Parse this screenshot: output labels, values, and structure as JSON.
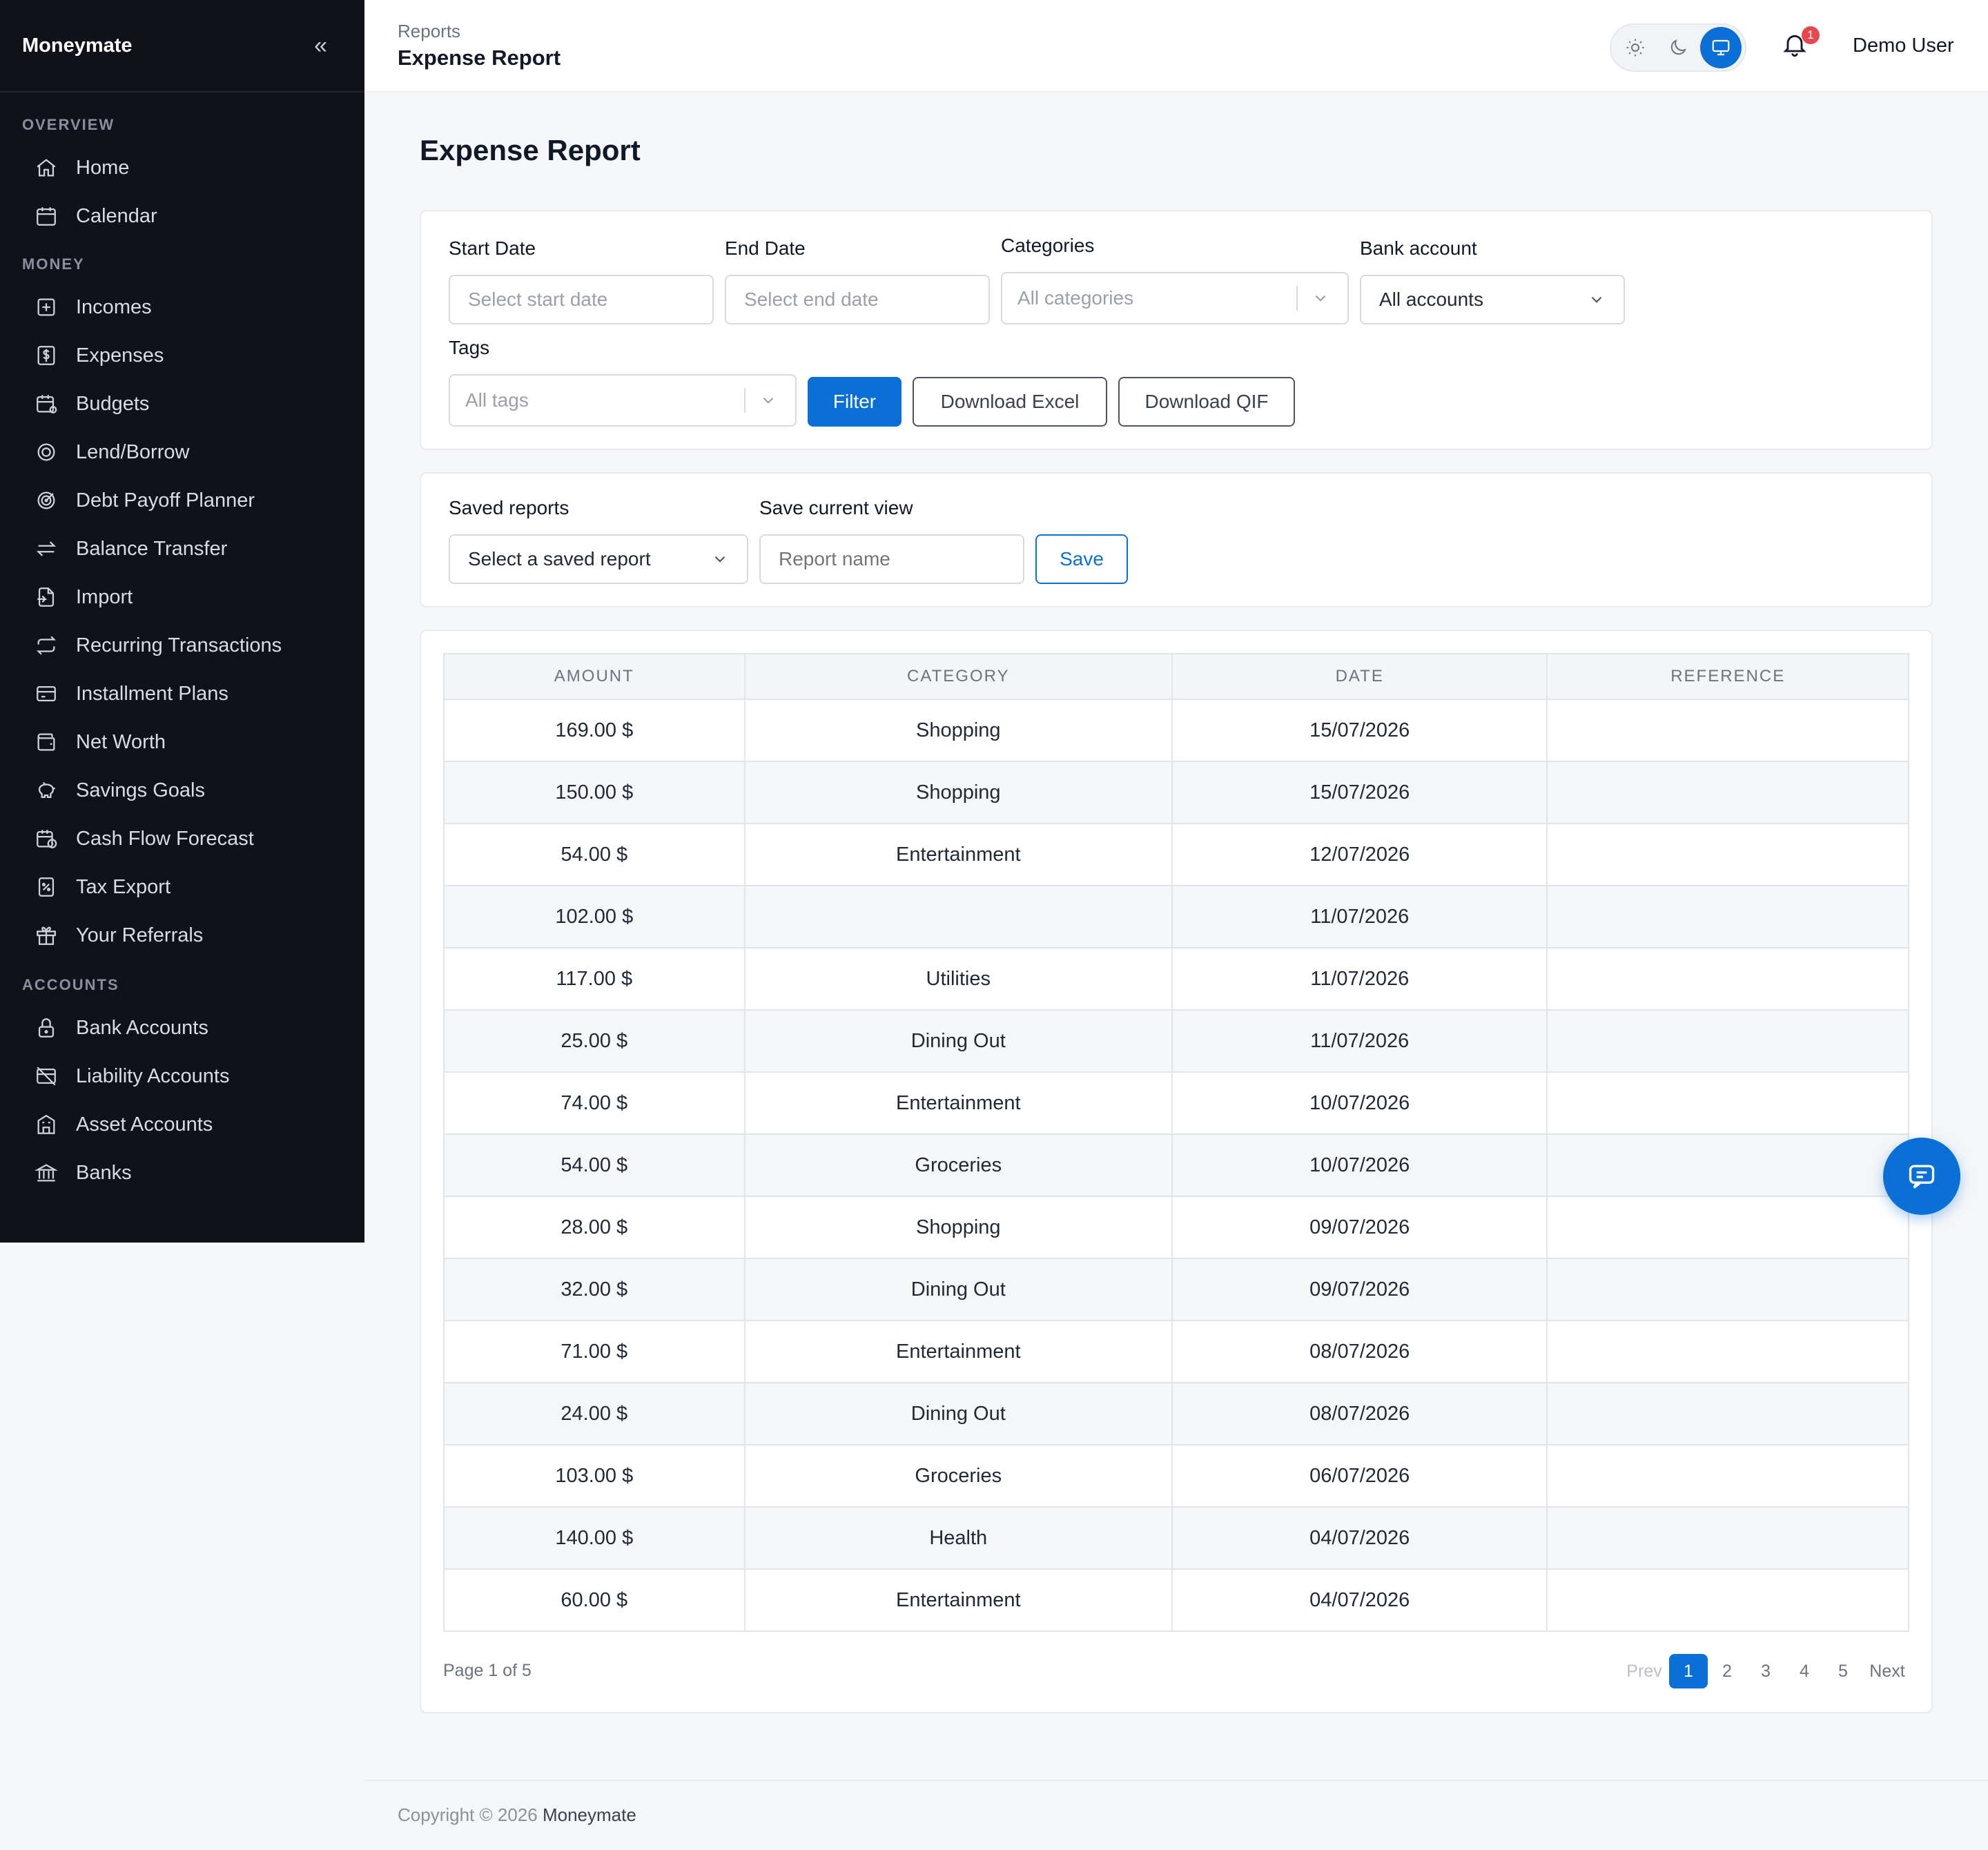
{
  "sidebar": {
    "brand": "Moneymate",
    "sections": {
      "overview": "OVERVIEW",
      "money": "MONEY",
      "accounts": "ACCOUNTS"
    },
    "items": {
      "home": "Home",
      "calendar": "Calendar",
      "incomes": "Incomes",
      "expenses": "Expenses",
      "budgets": "Budgets",
      "lend_borrow": "Lend/Borrow",
      "debt_payoff": "Debt Payoff Planner",
      "balance_transfer": "Balance Transfer",
      "import": "Import",
      "recurring": "Recurring Transactions",
      "installment": "Installment Plans",
      "net_worth": "Net Worth",
      "savings_goals": "Savings Goals",
      "cash_flow": "Cash Flow Forecast",
      "tax_export": "Tax Export",
      "referrals": "Your Referrals",
      "bank_accounts": "Bank Accounts",
      "liability_accounts": "Liability Accounts",
      "asset_accounts": "Asset Accounts",
      "banks": "Banks"
    }
  },
  "header": {
    "breadcrumb_parent": "Reports",
    "breadcrumb_current": "Expense Report",
    "notification_count": "1",
    "user_name": "Demo User"
  },
  "page": {
    "title": "Expense Report"
  },
  "filters": {
    "start_date_label": "Start Date",
    "start_date_placeholder": "Select start date",
    "end_date_label": "End Date",
    "end_date_placeholder": "Select end date",
    "categories_label": "Categories",
    "categories_placeholder": "All categories",
    "bank_account_label": "Bank account",
    "bank_account_value": "All accounts",
    "tags_label": "Tags",
    "tags_placeholder": "All tags",
    "filter_button": "Filter",
    "download_excel_button": "Download Excel",
    "download_qif_button": "Download QIF"
  },
  "saved": {
    "saved_reports_label": "Saved reports",
    "saved_reports_value": "Select a saved report",
    "save_view_label": "Save current view",
    "report_name_placeholder": "Report name",
    "save_button": "Save"
  },
  "table": {
    "headers": [
      "AMOUNT",
      "CATEGORY",
      "DATE",
      "REFERENCE"
    ],
    "rows": [
      {
        "amount": "169.00 $",
        "category": "Shopping",
        "date": "15/07/2026",
        "reference": ""
      },
      {
        "amount": "150.00 $",
        "category": "Shopping",
        "date": "15/07/2026",
        "reference": ""
      },
      {
        "amount": "54.00 $",
        "category": "Entertainment",
        "date": "12/07/2026",
        "reference": ""
      },
      {
        "amount": "102.00 $",
        "category": "",
        "date": "11/07/2026",
        "reference": ""
      },
      {
        "amount": "117.00 $",
        "category": "Utilities",
        "date": "11/07/2026",
        "reference": ""
      },
      {
        "amount": "25.00 $",
        "category": "Dining Out",
        "date": "11/07/2026",
        "reference": ""
      },
      {
        "amount": "74.00 $",
        "category": "Entertainment",
        "date": "10/07/2026",
        "reference": ""
      },
      {
        "amount": "54.00 $",
        "category": "Groceries",
        "date": "10/07/2026",
        "reference": ""
      },
      {
        "amount": "28.00 $",
        "category": "Shopping",
        "date": "09/07/2026",
        "reference": ""
      },
      {
        "amount": "32.00 $",
        "category": "Dining Out",
        "date": "09/07/2026",
        "reference": ""
      },
      {
        "amount": "71.00 $",
        "category": "Entertainment",
        "date": "08/07/2026",
        "reference": ""
      },
      {
        "amount": "24.00 $",
        "category": "Dining Out",
        "date": "08/07/2026",
        "reference": ""
      },
      {
        "amount": "103.00 $",
        "category": "Groceries",
        "date": "06/07/2026",
        "reference": ""
      },
      {
        "amount": "140.00 $",
        "category": "Health",
        "date": "04/07/2026",
        "reference": ""
      },
      {
        "amount": "60.00 $",
        "category": "Entertainment",
        "date": "04/07/2026",
        "reference": ""
      }
    ]
  },
  "pagination": {
    "info": "Page 1 of 5",
    "prev": "Prev",
    "pages": [
      "1",
      "2",
      "3",
      "4",
      "5"
    ],
    "current": "1",
    "next": "Next"
  },
  "footer": {
    "copyright": "Copyright © 2026",
    "brand": "Moneymate"
  },
  "colors": {
    "accent": "#0a6fd6",
    "sidebar_bg": "#111219",
    "badge": "#e5484d"
  },
  "icons": {
    "collapse": "double-chevron-left-icon",
    "theme": [
      "sun-icon",
      "moon-icon",
      "monitor-icon"
    ],
    "notification": "bell-icon",
    "chat": "chat-icon"
  }
}
